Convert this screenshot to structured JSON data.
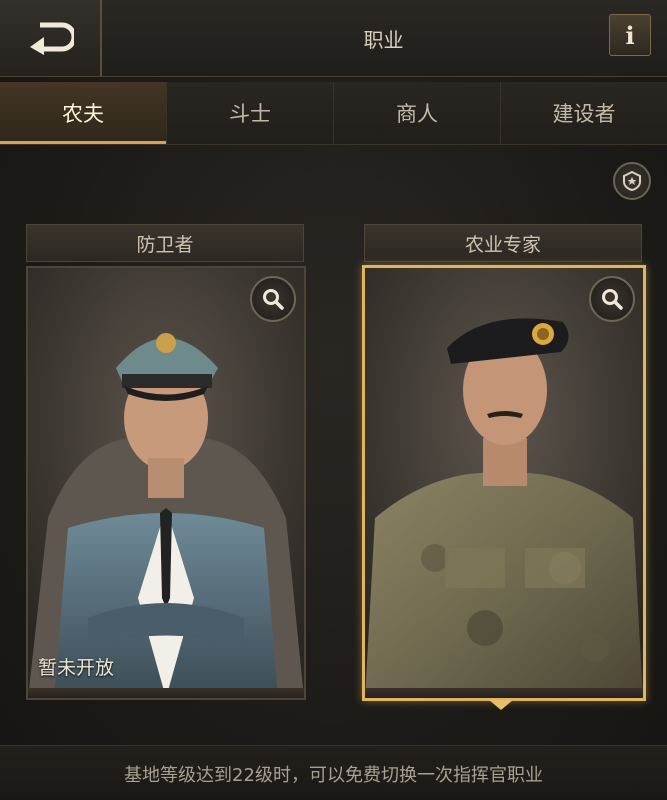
{
  "header": {
    "title": "职业",
    "back_icon": "back-arrow-icon",
    "info_label": "i"
  },
  "tabs": [
    {
      "label": "农夫",
      "active": true
    },
    {
      "label": "斗士",
      "active": false
    },
    {
      "label": "商人",
      "active": false
    },
    {
      "label": "建设者",
      "active": false
    }
  ],
  "filter_icon": "badge-filter-icon",
  "cards": [
    {
      "title": "防卫者",
      "status": "暂未开放",
      "selected": false,
      "zoom_icon": "magnifier-icon"
    },
    {
      "title": "农业专家",
      "status": "",
      "selected": true,
      "zoom_icon": "magnifier-icon"
    }
  ],
  "footer": {
    "note": "基地等级达到22级时，可以免费切换一次指挥官职业"
  },
  "colors": {
    "accent_gold": "#d6a24c",
    "selected_border": "#e0b55e",
    "background": "#1c1a17"
  }
}
